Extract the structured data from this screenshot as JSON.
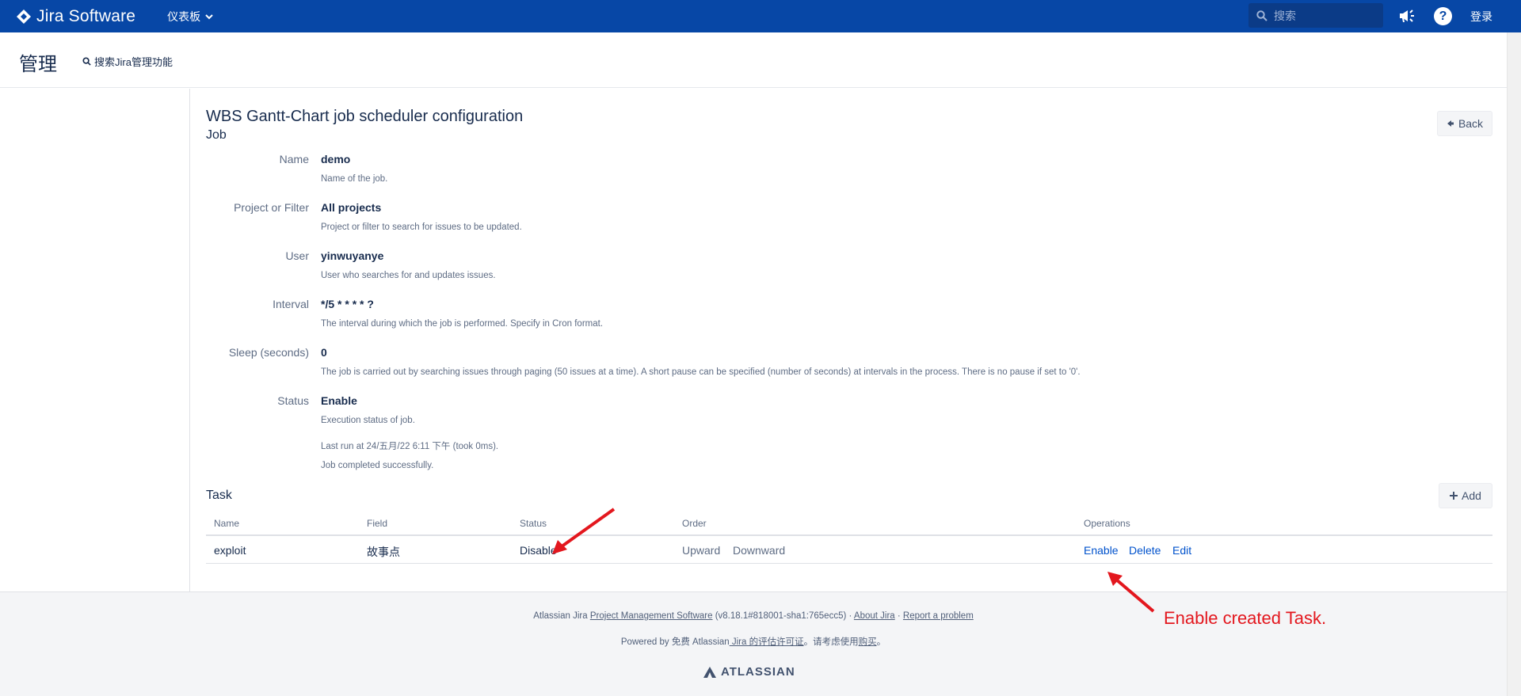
{
  "topnav": {
    "product_name": "Jira Software",
    "dashboard_label": "仪表板",
    "search_placeholder": "搜索",
    "login_label": "登录",
    "bg_color": "#0747a6"
  },
  "admin_header": {
    "title": "管理",
    "search_link": "搜索Jira管理功能"
  },
  "page": {
    "title": "WBS Gantt-Chart job scheduler configuration",
    "job_heading": "Job",
    "back_label": "Back",
    "task_heading": "Task",
    "add_label": "Add"
  },
  "job_fields": [
    {
      "label": "Name",
      "value": "demo",
      "desc": "Name of the job."
    },
    {
      "label": "Project or Filter",
      "value": "All projects",
      "desc": "Project or filter to search for issues to be updated."
    },
    {
      "label": "User",
      "value": "yinwuyanye",
      "desc": "User who searches for and updates issues."
    },
    {
      "label": "Interval",
      "value": "*/5 * * * * ?",
      "desc": "The interval during which the job is performed. Specify in Cron format."
    },
    {
      "label": "Sleep (seconds)",
      "value": "0",
      "desc": "The job is carried out by searching issues through paging (50 issues at a time). A short pause can be specified (number of seconds) at intervals in the process. There is no pause if set to '0'."
    },
    {
      "label": "Status",
      "value": "Enable",
      "desc": "Execution status of job.",
      "last_run": "Last run at 24/五月/22 6:11 下午 (took 0ms).",
      "result": "Job completed successfully."
    }
  ],
  "task_table": {
    "headers": [
      "Name",
      "Field",
      "Status",
      "Order",
      "Operations"
    ],
    "rows": [
      {
        "name": "exploit",
        "field": "故事点",
        "status": "Disable",
        "order_up": "Upward",
        "order_down": "Downward",
        "op_enable": "Enable",
        "op_delete": "Delete",
        "op_edit": "Edit"
      }
    ]
  },
  "footer": {
    "line1_prefix": "Atlassian Jira ",
    "line1_link1": "Project Management Software",
    "line1_version": " (v8.18.1#818001-sha1:765ecc5)",
    "line1_sep": " · ",
    "line1_link2": "About Jira",
    "line1_link3": "Report a problem",
    "line2_prefix": "Powered by 免费 Atlassian",
    "line2_link1": " Jira 的评估许可证",
    "line2_mid": "。请考虑使用",
    "line2_link2": "购买",
    "line2_suffix": "。",
    "logo_text": "ATLASSIAN"
  },
  "annotation": {
    "text": "Enable created Task.",
    "color": "#e3171e"
  }
}
